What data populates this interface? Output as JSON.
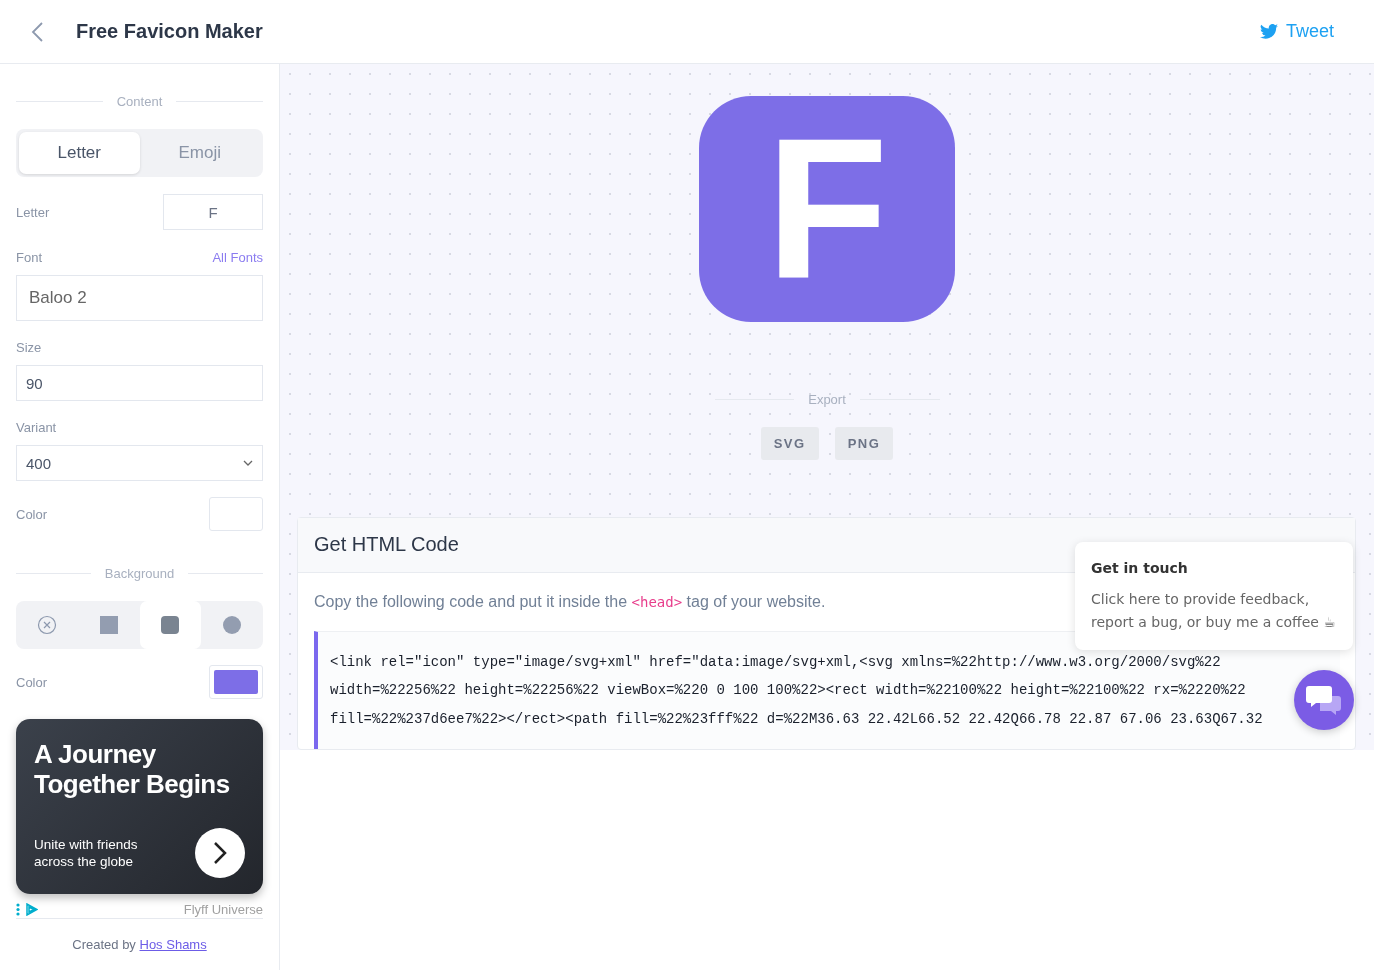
{
  "header": {
    "title": "Free Favicon Maker",
    "tweet": "Tweet"
  },
  "sidebar": {
    "content_label": "Content",
    "content_tabs": [
      {
        "label": "Letter",
        "selected": true
      },
      {
        "label": "Emoji",
        "selected": false
      }
    ],
    "letter": {
      "label": "Letter",
      "value": "F"
    },
    "font": {
      "label": "Font",
      "link": "All Fonts",
      "value": "Baloo 2"
    },
    "size": {
      "label": "Size",
      "value": "90"
    },
    "variant": {
      "label": "Variant",
      "value": "400"
    },
    "text_color": {
      "label": "Color",
      "color": "#ffffff"
    },
    "background_label": "Background",
    "shapes": [
      {
        "kind": "none",
        "selected": false
      },
      {
        "kind": "square",
        "selected": false
      },
      {
        "kind": "rounded",
        "selected": true
      },
      {
        "kind": "circle",
        "selected": false
      }
    ],
    "background_color": {
      "label": "Color",
      "color": "#7d6ee7"
    },
    "ad": {
      "title": "A Journey Together Begins",
      "text": "Unite with friends across the globe",
      "sponsor": "Flyff Universe"
    },
    "credit": {
      "text": "Created by",
      "link": "Hos Shams"
    }
  },
  "preview": {
    "letter": "F",
    "color": "#7d6ee7"
  },
  "export": {
    "label": "Export",
    "buttons": [
      "SVG",
      "PNG"
    ]
  },
  "html_code": {
    "title": "Get HTML Code",
    "intro_before": "Copy the following code and put it inside the",
    "tag": "<head>",
    "intro_after": "tag of your website.",
    "lines": [
      "<link rel=\"icon\" type=\"image/svg+xml\" href=\"data:image/svg+xml,<svg xmlns=%22http://www.w3.org/2000/svg%22",
      "width=%22256%22 height=%22256%22 viewBox=%220 0 100 100%22><rect width=%22100%22 height=%22100%22 rx=%2220%22",
      "fill=%22%237d6ee7%22></rect><path fill=%22%23fff%22 d=%22M36.63 22.42L66.52 22.42Q66.78 22.87 67.06 23.63Q67.32"
    ]
  },
  "popover": {
    "title": "Get in touch",
    "text": "Click here to provide feedback, report a bug, or buy me a coffee ☕"
  }
}
